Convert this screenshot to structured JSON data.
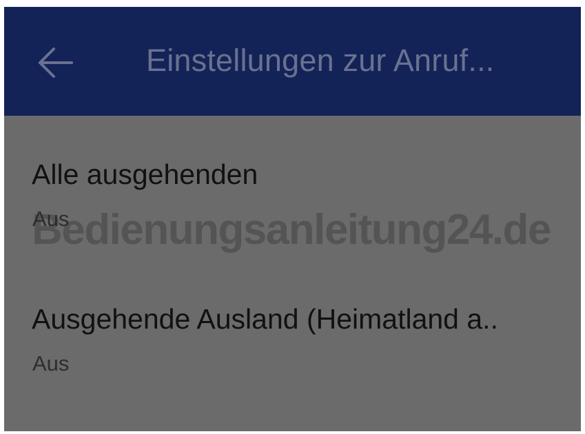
{
  "app_bar": {
    "back_icon": "arrow-back-icon",
    "title": "Einstellungen zur Anruf..."
  },
  "settings": [
    {
      "title": "Alle ausgehenden",
      "subtitle": "Aus"
    },
    {
      "title": "Ausgehende Ausland (Heimatland a..",
      "subtitle": "Aus"
    }
  ],
  "watermark": "Bedienungsanleitung24.de",
  "colors": {
    "app_bar": "#132358",
    "dim_overlay": "#6b6b6b"
  }
}
